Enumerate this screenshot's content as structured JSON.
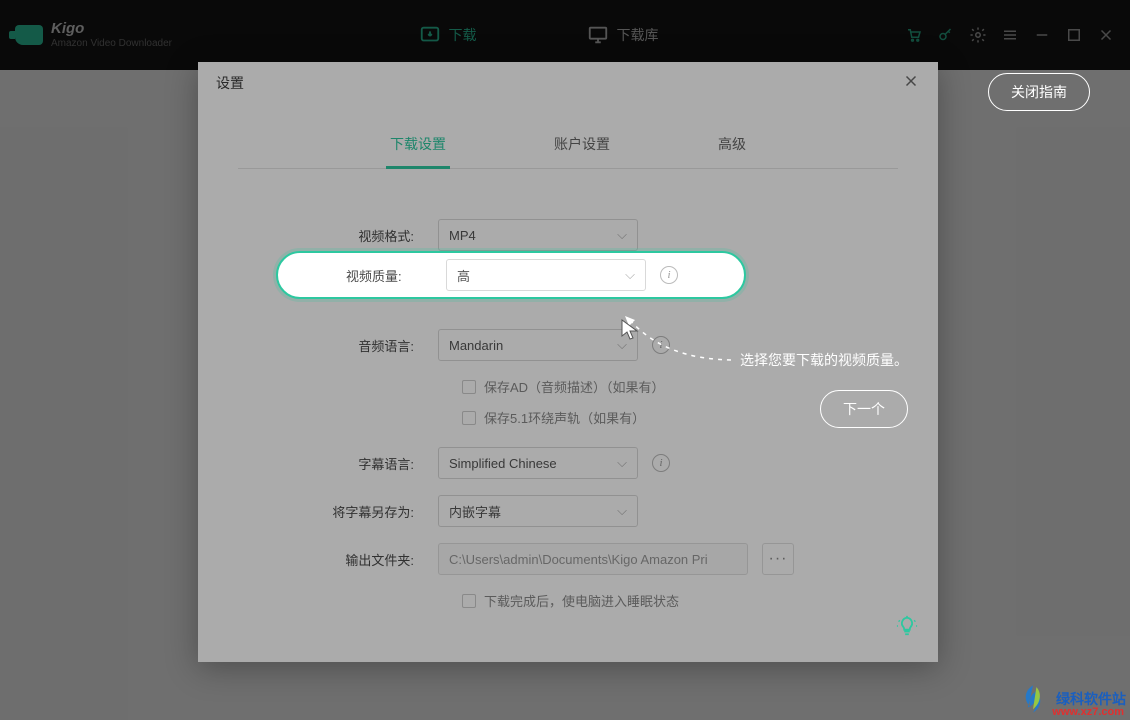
{
  "app": {
    "name": "Kigo",
    "subtitle": "Amazon Video Downloader"
  },
  "nav": {
    "download": "下载",
    "library": "下载库"
  },
  "guide": {
    "close_label": "关闭指南",
    "callout_text": "选择您要下载的视频质量。",
    "next_label": "下一个"
  },
  "modal": {
    "title": "设置",
    "tabs": {
      "download": "下载设置",
      "account": "账户设置",
      "advanced": "高级"
    },
    "labels": {
      "video_format": "视频格式:",
      "video_quality": "视频质量:",
      "audio_language": "音频语言:",
      "subtitle_language": "字幕语言:",
      "save_subtitle_as": "将字幕另存为:",
      "output_folder": "输出文件夹:"
    },
    "values": {
      "video_format": "MP4",
      "video_quality": "高",
      "audio_language": "Mandarin",
      "subtitle_language": "Simplified Chinese",
      "save_subtitle_as": "内嵌字幕",
      "output_folder": "C:\\Users\\admin\\Documents\\Kigo Amazon Pri"
    },
    "checkboxes": {
      "save_ad": "保存AD（音频描述）（如果有）",
      "save_51": "保存5.1环绕声轨（如果有）",
      "sleep_after": "下载完成后，使电脑进入睡眠状态"
    },
    "browse": "···"
  },
  "icons": {
    "cart": "cart-icon",
    "key": "key-icon",
    "gear": "gear-icon",
    "menu": "menu-icon",
    "minimize": "minimize-icon",
    "maximize": "maximize-icon",
    "close_win": "close-window-icon",
    "close_modal": "close-modal-icon",
    "info": "info-icon",
    "bulb": "lightbulb-icon"
  },
  "watermark": {
    "text": "绿科软件站",
    "url": "www.xz7.com"
  }
}
